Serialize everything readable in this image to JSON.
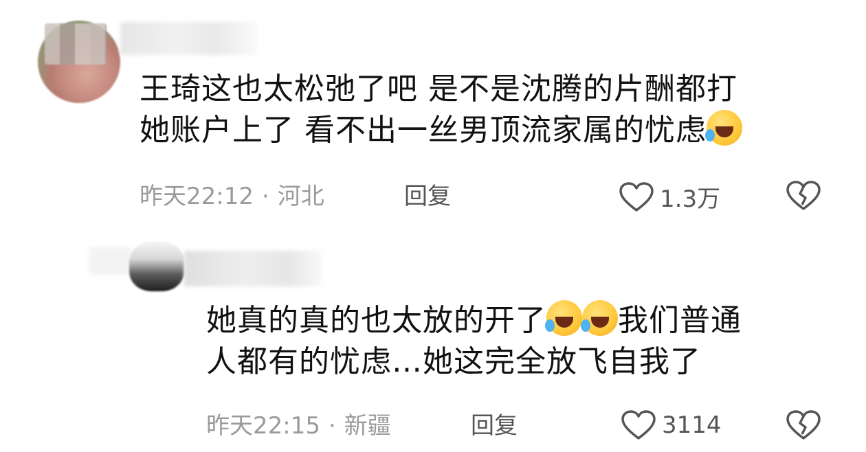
{
  "comments": [
    {
      "text_line1": "王琦这也太松弛了吧 是不是沈腾的片酬都打",
      "text_line2": "她账户上了 看不出一丝男顶流家属的忧虑",
      "time": "昨天22:12",
      "location": "河北",
      "reply_label": "回复",
      "like_count": "1.3万"
    },
    {
      "text_line1_a": "她真的真的也太放的开了",
      "text_line1_b": "我们普通",
      "text_line2": "人都有的忧虑…她这完全放飞自我了",
      "time": "昨天22:15",
      "location": "新疆",
      "reply_label": "回复",
      "like_count": "3114"
    }
  ],
  "separator": "·",
  "icons": [
    "heart-icon",
    "broken-heart-icon",
    "laugh-cry-emoji"
  ],
  "colors": {
    "text": "#111111",
    "meta": "#9a9a9a",
    "action": "#555555"
  }
}
